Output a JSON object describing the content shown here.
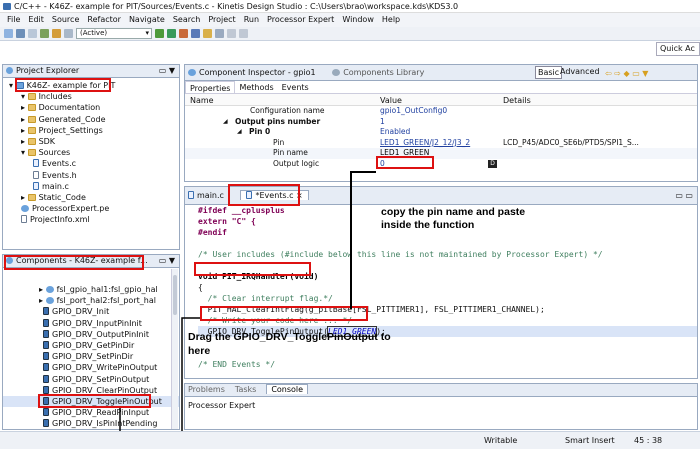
{
  "window": {
    "title": "C/C++ - K46Z- example for PIT/Sources/Events.c - Kinetis Design Studio : C:\\Users\\brao\\workspace.kds\\KDS3.0"
  },
  "menu": [
    "File",
    "Edit",
    "Source",
    "Refactor",
    "Navigate",
    "Search",
    "Project",
    "Run",
    "Processor Expert",
    "Window",
    "Help"
  ],
  "toolbar": {
    "config_combo": "(Active)",
    "quick_access": "Quick Ac"
  },
  "project_explorer": {
    "tab_label": "Project Explorer",
    "project": "K46Z- example for PIT",
    "items": [
      {
        "label": "Includes",
        "indent": 1,
        "icon": "folder"
      },
      {
        "label": "Documentation",
        "indent": 1,
        "icon": "folder"
      },
      {
        "label": "Generated_Code",
        "indent": 1,
        "icon": "folder"
      },
      {
        "label": "Project_Settings",
        "indent": 1,
        "icon": "folder"
      },
      {
        "label": "SDK",
        "indent": 1,
        "icon": "folder"
      },
      {
        "label": "Sources",
        "indent": 1,
        "icon": "folder"
      },
      {
        "label": "Events.c",
        "indent": 2,
        "icon": "c-file"
      },
      {
        "label": "Events.h",
        "indent": 2,
        "icon": "h-file"
      },
      {
        "label": "main.c",
        "indent": 2,
        "icon": "c-file"
      },
      {
        "label": "Static_Code",
        "indent": 1,
        "icon": "folder"
      },
      {
        "label": "ProcessorExpert.pe",
        "indent": 1,
        "icon": "pe-file"
      },
      {
        "label": "ProjectInfo.xml",
        "indent": 1,
        "icon": "xml-file"
      }
    ]
  },
  "components": {
    "tab_label": "Components - K46Z- example f...",
    "items": [
      "fsl_gpio_hal1:fsl_gpio_hal",
      "fsl_port_hal2:fsl_port_hal",
      "GPIO_DRV_Init",
      "GPIO_DRV_InputPinInit",
      "GPIO_DRV_OutputPinInit",
      "GPIO_DRV_GetPinDir",
      "GPIO_DRV_SetPinDir",
      "GPIO_DRV_WritePinOutput",
      "GPIO_DRV_SetPinOutput",
      "GPIO_DRV_ClearPinOutput",
      "GPIO_DRV_TogglePinOutput",
      "GPIO_DRV_ReadPinInput",
      "GPIO_DRV_IsPinIntPending"
    ]
  },
  "inspector": {
    "tab_label": "Component Inspector - gpio1",
    "tab2_label": "Components Library",
    "basic": "Basic",
    "advanced": "Advanced",
    "subtabs": [
      "Properties",
      "Methods",
      "Events"
    ],
    "columns": [
      "Name",
      "Value",
      "Details"
    ],
    "rows": [
      {
        "name": "Configuration name",
        "value": "gpio1_OutConfig0",
        "details": ""
      },
      {
        "name": "Output pins number",
        "value": "1",
        "details": ""
      },
      {
        "name": "Pin 0",
        "value": "Enabled",
        "details": ""
      },
      {
        "name": "Pin",
        "value": "LED1_GREEN/J2_12/J3_2",
        "details": "LCD_P45/ADC0_SE6b/PTD5/SPI1_S..."
      },
      {
        "name": "Pin name",
        "value": "LED1_GREEN",
        "details": ""
      },
      {
        "name": "Output logic",
        "value": "0",
        "details": ""
      }
    ]
  },
  "editor": {
    "tabs": [
      "main.c",
      "*Events.c"
    ],
    "lines": [
      {
        "k": "pp",
        "t": "#ifdef __cplusplus"
      },
      {
        "k": "pp",
        "t": "extern \"C\" {"
      },
      {
        "k": "pp",
        "t": "#endif"
      },
      {
        "k": "blank",
        "t": ""
      },
      {
        "k": "cm",
        "t": "/* User includes (#include below this line is not maintained by Processor Expert) */"
      },
      {
        "k": "blank",
        "t": ""
      },
      {
        "k": "fn",
        "t": "void PIT_IRQHandler(void)"
      },
      {
        "k": "code",
        "t": "{"
      },
      {
        "k": "cm",
        "t": "  /* Clear interrupt flag.*/"
      },
      {
        "k": "code",
        "t": "  PIT_HAL_ClearIntFlag(g_pitBase[FSL_PITTIMER1], FSL_PITTIMER1_CHANNEL);"
      },
      {
        "k": "cm",
        "t": "  /* Write your code here ... */"
      },
      {
        "k": "call",
        "t": "  GPIO_DRV_TogglePinOutput(LED1_GREEN);"
      },
      {
        "k": "blank",
        "t": ""
      },
      {
        "k": "blank",
        "t": ""
      },
      {
        "k": "cm",
        "t": "/* END Events */"
      }
    ]
  },
  "annotations": {
    "copy": "copy the pin name and paste inside the function",
    "drag": "Drag the GPIO_DRV_TogglePinOutput to here"
  },
  "console": {
    "tabs": [
      "Problems",
      "Tasks",
      "Console"
    ],
    "content": "Processor Expert"
  },
  "status": {
    "writable": "Writable",
    "insert": "Smart Insert",
    "position": "45 : 38"
  },
  "colors": {
    "annotation_red": "#dd1111",
    "selection": "#d9e4f7"
  }
}
